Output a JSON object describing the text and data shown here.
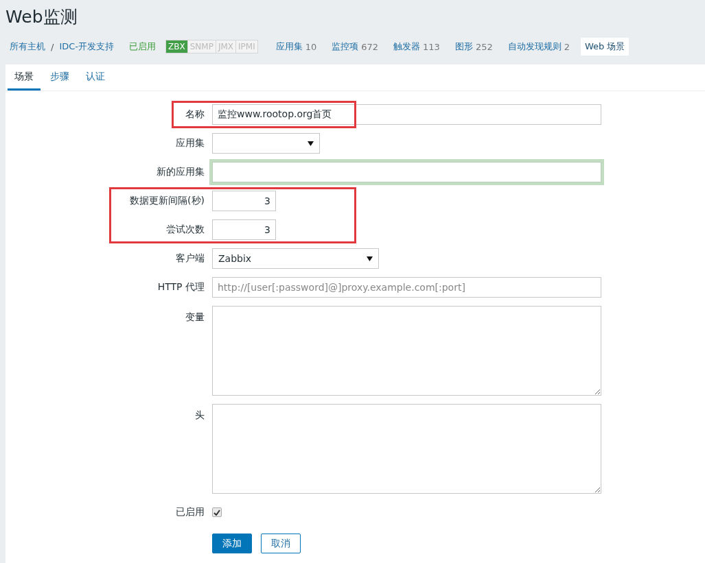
{
  "page_title": "Web监测",
  "breadcrumb": {
    "items": [
      "所有主机",
      "IDC-开发支持"
    ],
    "separator": "/"
  },
  "host_status": "已启用",
  "availability": [
    {
      "label": "ZBX",
      "on": true
    },
    {
      "label": "SNMP",
      "on": false
    },
    {
      "label": "JMX",
      "on": false
    },
    {
      "label": "IPMI",
      "on": false
    }
  ],
  "nav_links": [
    {
      "label": "应用集",
      "count": "10",
      "selected": false
    },
    {
      "label": "监控项",
      "count": "672",
      "selected": false
    },
    {
      "label": "触发器",
      "count": "113",
      "selected": false
    },
    {
      "label": "图形",
      "count": "252",
      "selected": false
    },
    {
      "label": "自动发现规则",
      "count": "2",
      "selected": false
    },
    {
      "label": "Web 场景",
      "selected": true
    }
  ],
  "tabs": [
    {
      "label": "场景",
      "selected": true
    },
    {
      "label": "步骤",
      "selected": false
    },
    {
      "label": "认证",
      "selected": false
    }
  ],
  "form": {
    "fields": [
      {
        "kind": "text",
        "label": "名称",
        "value": "监控www.rootop.org首页",
        "highlighted": true,
        "focused": false
      },
      {
        "kind": "select",
        "label": "应用集",
        "highlighted": false,
        "focused": false
      },
      {
        "kind": "text",
        "label": "新的应用集",
        "highlighted": false,
        "focused": true
      },
      {
        "kind": "number",
        "label": "数据更新间隔(秒)",
        "value": "3",
        "highlighted": true,
        "focused": false
      },
      {
        "kind": "number",
        "label": "尝试次数",
        "value": "3",
        "highlighted": true,
        "focused": false
      },
      {
        "kind": "select",
        "label": "客户端",
        "value": "Zabbix",
        "highlighted": false,
        "focused": false
      },
      {
        "kind": "text",
        "label": "HTTP 代理",
        "placeholder": "http://[user[:password]@]proxy.example.com[:port]",
        "highlighted": false,
        "focused": false
      },
      {
        "kind": "textarea",
        "label": "变量",
        "highlighted": false,
        "focused": false
      },
      {
        "kind": "textarea",
        "label": "头",
        "highlighted": false,
        "focused": false
      },
      {
        "kind": "checkbox",
        "label": "已启用",
        "checked": true,
        "highlighted": false,
        "focused": false
      }
    ]
  },
  "buttons": [
    {
      "label": "添加",
      "kind": "primary"
    },
    {
      "label": "取消",
      "kind": "secondary"
    }
  ]
}
